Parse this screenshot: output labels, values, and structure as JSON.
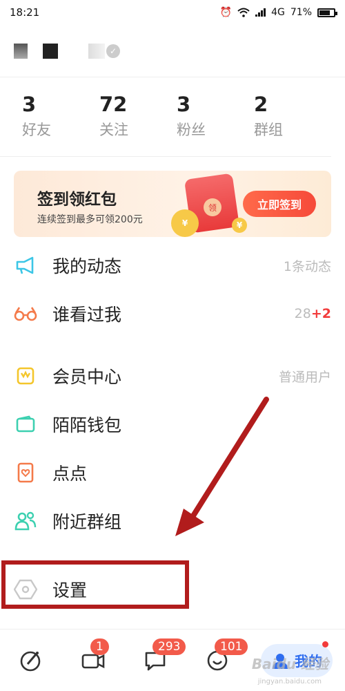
{
  "status_bar": {
    "time": "18:21",
    "network": "4G",
    "battery": "71%"
  },
  "stats": [
    {
      "value": "3",
      "label": "好友"
    },
    {
      "value": "72",
      "label": "关注"
    },
    {
      "value": "3",
      "label": "粉丝"
    },
    {
      "value": "2",
      "label": "群组"
    }
  ],
  "banner": {
    "title": "签到领红包",
    "subtitle": "连续签到最多可领200元",
    "button": "立即签到",
    "seal": "领",
    "coin_symbol": "¥"
  },
  "menu": {
    "dynamics": {
      "label": "我的动态",
      "value": "1条动态"
    },
    "visitors": {
      "label": "谁看过我",
      "value": "28",
      "plus": "+2"
    },
    "vip": {
      "label": "会员中心",
      "value": "普通用户"
    },
    "wallet": {
      "label": "陌陌钱包"
    },
    "dots": {
      "label": "点点"
    },
    "groups": {
      "label": "附近群组"
    },
    "settings": {
      "label": "设置"
    }
  },
  "tabbar": {
    "video_badge": "1",
    "messages_badge": "293",
    "contacts_badge": "101",
    "me_label": "我的"
  },
  "watermark": {
    "brand": "Baidu 经验",
    "url": "jingyan.baidu.com"
  },
  "colors": {
    "accent_red": "#f23b3b",
    "annotation_red": "#b11c1c",
    "me_blue": "#2f6df0"
  }
}
